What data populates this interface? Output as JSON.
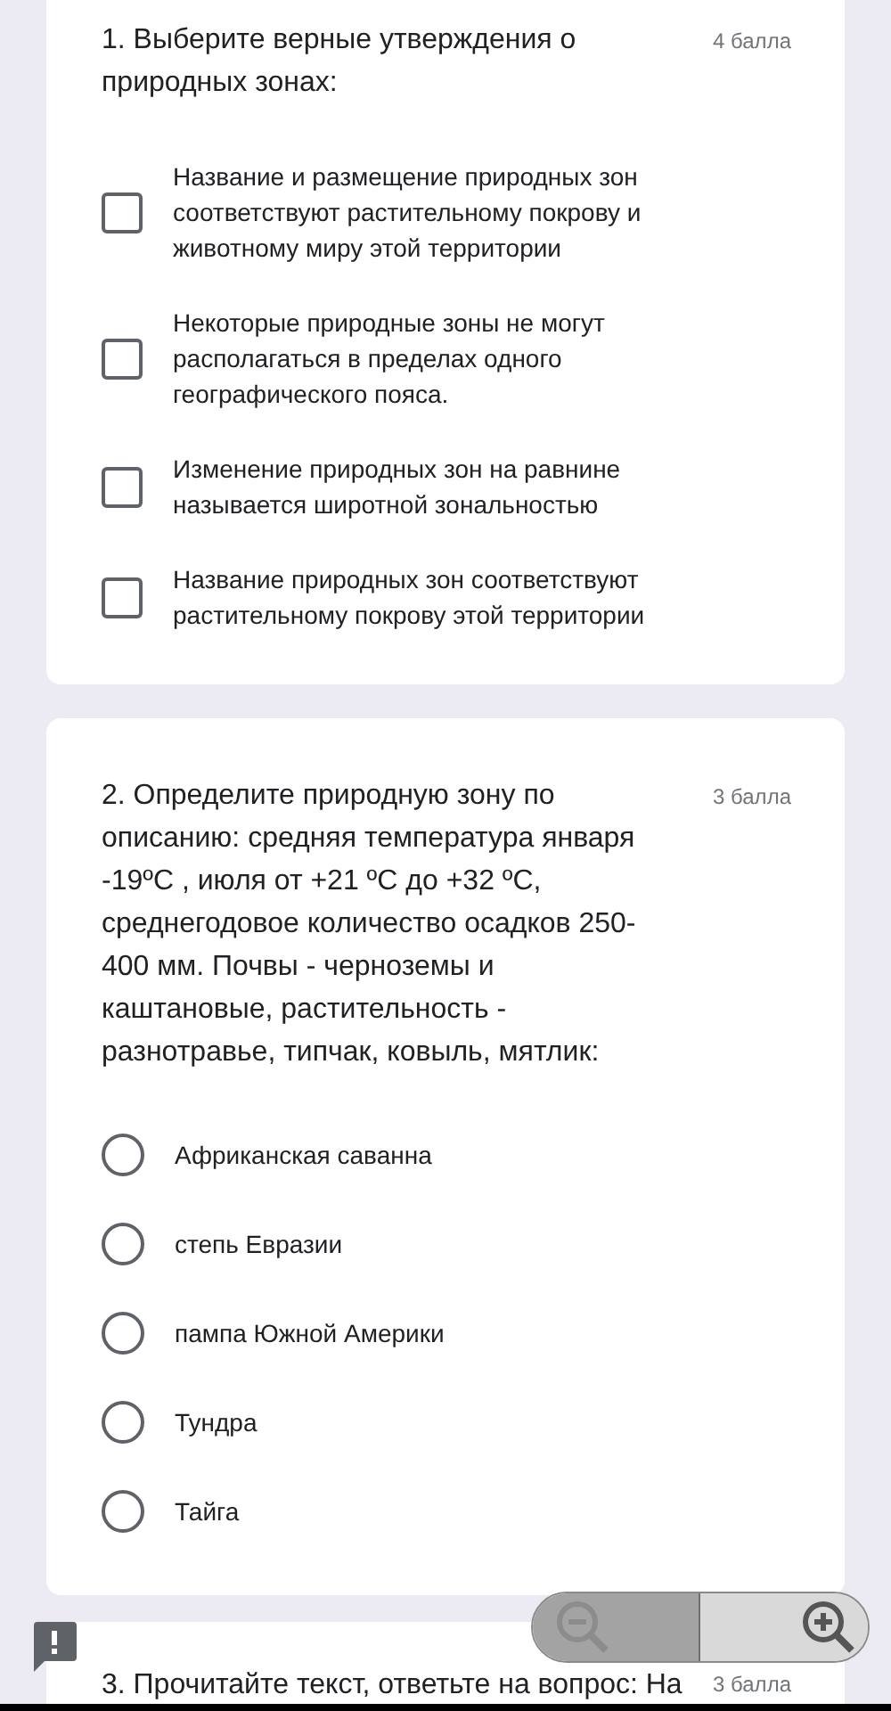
{
  "questions": [
    {
      "kind": "checkbox",
      "title": "1. Выберите верные утверждения о природных зонах:",
      "points": "4 балла",
      "options": [
        {
          "label": "Название и размещение природных зон соответствуют растительному покрову и животному миру этой территории",
          "checked": false
        },
        {
          "label": "Некоторые природные зоны не могут располагаться в пределах одного географического пояса.",
          "checked": false
        },
        {
          "label": "Изменение природных зон на равнине называется широтной зональностью",
          "checked": false
        },
        {
          "label": "Название природных зон соответствуют растительному покрову этой территории",
          "checked": false
        }
      ]
    },
    {
      "kind": "radio",
      "title": "2. Определите природную зону по описанию: средняя температура января -19ºC , июля от +21 ºC до +32 ºC, среднегодовое количество осадков 250-400 мм. Почвы - черноземы и каштановые, растительность - разнотравье, типчак, ковыль, мятлик:",
      "points": "3 балла",
      "options": [
        {
          "label": "Африканская саванна",
          "selected": false
        },
        {
          "label": "степь Евразии",
          "selected": false
        },
        {
          "label": "пампа Южной Америки",
          "selected": false
        },
        {
          "label": "Тундра",
          "selected": false
        },
        {
          "label": "Тайга",
          "selected": false
        }
      ]
    },
    {
      "kind": "partial",
      "title": "3. Прочитайте текст, ответьте на вопрос: На",
      "points": "3 балла"
    }
  ]
}
